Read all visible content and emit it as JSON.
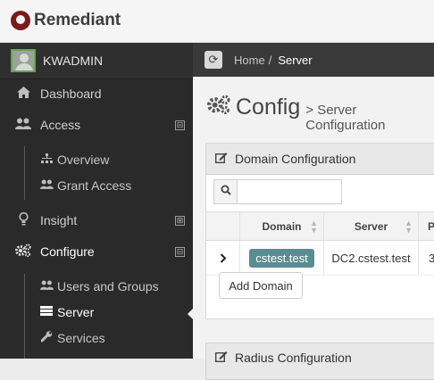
{
  "brand": {
    "name": "Remediant"
  },
  "user": {
    "name": "KWADMIN"
  },
  "breadcrumb": {
    "home": "Home",
    "separator": "/",
    "current": "Server"
  },
  "nav": {
    "dashboard": "Dashboard",
    "access": "Access",
    "access_children": {
      "overview": "Overview",
      "grant_access": "Grant Access"
    },
    "insight": "Insight",
    "configure": "Configure",
    "configure_children": {
      "users_groups": "Users and Groups",
      "server": "Server",
      "services": "Services"
    },
    "toggle_expanded": "⊟",
    "toggle_collapsed": "⊞"
  },
  "page": {
    "title": "Config",
    "subtitle": "> Server Configuration"
  },
  "domain_panel": {
    "title": "Domain Configuration",
    "search": {
      "value": "",
      "placeholder": ""
    },
    "columns": [
      "Domain",
      "Server",
      "P"
    ],
    "rows": [
      {
        "domain": "cstest.test",
        "server": "DC2.cstest.test",
        "p": "3"
      }
    ],
    "add_button": "Add Domain"
  },
  "radius_panel": {
    "title": "Radius Configuration"
  },
  "icons": {
    "logo": "remediant-logo",
    "avatar": "user-avatar",
    "dashboard": "home-icon",
    "access": "users-icon",
    "overview": "sitemap-icon",
    "grant_access": "users-icon",
    "insight": "lightbulb-icon",
    "configure": "cogs-icon",
    "users_groups": "users-icon",
    "server": "server-icon",
    "services": "wrench-icon",
    "refresh": "refresh-icon",
    "edit": "edit-icon",
    "search": "search-icon",
    "expand": "chevron-right-icon",
    "sort": "sort-icon"
  },
  "colors": {
    "sidebar": "#2a2a2a",
    "breadcrumb_bar": "#3a3a3a",
    "tag": "#5a8c92",
    "avatar_border": "#62a84d",
    "logo": "#7a1a1a"
  }
}
